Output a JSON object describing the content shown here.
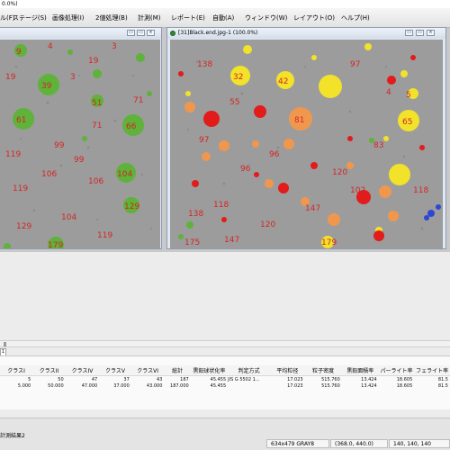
{
  "app": {
    "title_fragment": "0.0%)"
  },
  "menu": [
    {
      "label": "ル(F)"
    },
    {
      "label": "ステージ(S)"
    },
    {
      "label": "画像処理(I)"
    },
    {
      "label": "2値処理(B)"
    },
    {
      "label": "計測(M)"
    },
    {
      "label": "レポート(E)"
    },
    {
      "label": "自動(A)"
    },
    {
      "label": "ウィンドウ(W)"
    },
    {
      "label": "レイアウト(O)"
    },
    {
      "label": "ヘルプ(H)"
    }
  ],
  "windows": {
    "left": {
      "title": ""
    },
    "right": {
      "title": "[31]Black.end.jpg-1 (100.0%)"
    }
  },
  "window_buttons": {
    "minimize": "▭",
    "restore": "▭",
    "close": "×"
  },
  "particle_labels_left": [
    "9",
    "4",
    "3",
    "19",
    "39",
    "61",
    "51",
    "66",
    "104",
    "129",
    "179",
    "71",
    "99",
    "106",
    "119"
  ],
  "particle_labels_right": [
    "32",
    "42",
    "65",
    "81",
    "55",
    "97",
    "83",
    "96",
    "102",
    "138",
    "120",
    "179",
    "118",
    "147",
    "175",
    "4",
    "5"
  ],
  "colors": {
    "green": "#5fb23a",
    "yellow": "#f2e22a",
    "orange": "#f0974e",
    "red": "#e21b1b",
    "blue": "#2e47d3",
    "label_red": "#d42525",
    "image_bg": "#9c9c9c"
  },
  "tab": {
    "label": "1"
  },
  "table": {
    "headers": [
      "クラスI",
      "クラスII",
      "クラスIV",
      "クラスV",
      "クラスVI",
      "総計",
      "黒鉛球状化率",
      "判定方式",
      "平均粒径",
      "粒子密度",
      "黒鉛面積率",
      "パーライト率",
      "フェライト率"
    ],
    "rows": [
      [
        "5",
        "50",
        "47",
        "37",
        "43",
        "187",
        "45.455",
        "JIS G 5502 1...",
        "17.023",
        "515.760",
        "13.424",
        "18.605",
        "81.5"
      ],
      [
        "5.000",
        "50.000",
        "47.000",
        "37.000",
        "43.000",
        "187.000",
        "45.455",
        "",
        "17.023",
        "515.760",
        "13.424",
        "18.605",
        "81.5"
      ]
    ]
  },
  "status": {
    "document": "計測結果2",
    "image_info": "634x479 GRAY8",
    "coords": "(368.0, 440.0)",
    "pixel_value": "140, 140, 140"
  }
}
